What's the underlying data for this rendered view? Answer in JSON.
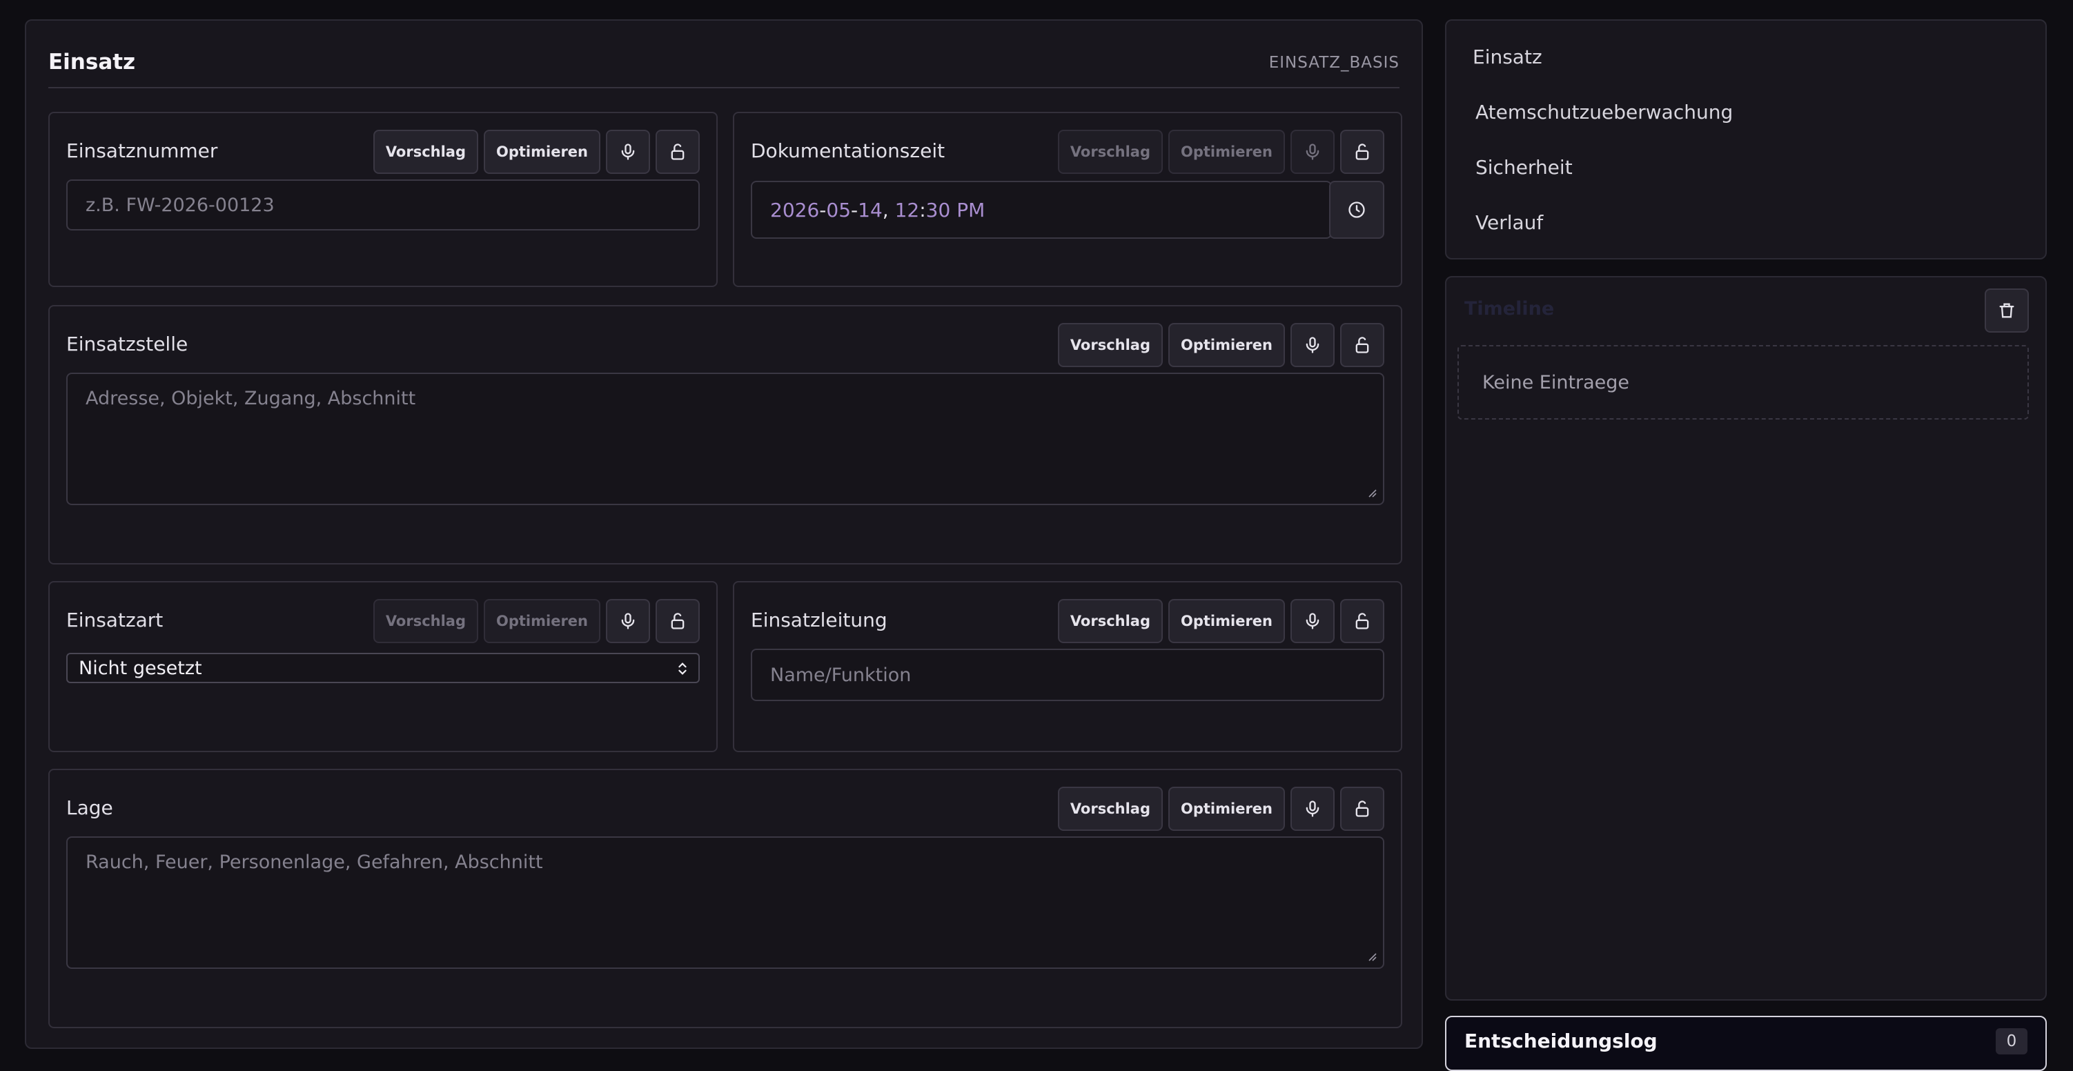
{
  "main": {
    "title": "Einsatz",
    "code": "EINSATZ_BASIS"
  },
  "buttons": {
    "suggest": "Vorschlag",
    "optimize": "Optimieren"
  },
  "fields": {
    "einsatznummer": {
      "label": "Einsatznummer",
      "placeholder": "z.B. FW-2026-00123"
    },
    "dokumentationszeit": {
      "label": "Dokumentationszeit",
      "date_year": "2026",
      "date_month": "05",
      "date_day": "14",
      "time_hour": "12",
      "time_minute": "30",
      "time_ampm": "PM"
    },
    "einsatzstelle": {
      "label": "Einsatzstelle",
      "placeholder": "Adresse, Objekt, Zugang, Abschnitt"
    },
    "einsatzart": {
      "label": "Einsatzart",
      "selected": "Nicht gesetzt"
    },
    "einsatzleitung": {
      "label": "Einsatzleitung",
      "placeholder": "Name/Funktion"
    },
    "lage": {
      "label": "Lage",
      "placeholder": "Rauch, Feuer, Personenlage, Gefahren, Abschnitt"
    }
  },
  "sidebar": {
    "items": [
      {
        "label": "Einsatz"
      },
      {
        "label": "Atemschutzueberwachung"
      },
      {
        "label": "Sicherheit"
      },
      {
        "label": "Verlauf"
      }
    ]
  },
  "log": {
    "title": "Timeline",
    "empty_text": "Keine Eintraege"
  },
  "decision_log": {
    "title": "Entscheidungslog",
    "count": "0"
  },
  "icons": {
    "mic": "microphone-icon",
    "lock": "unlock-icon",
    "clock": "clock-icon",
    "trash": "trash-icon",
    "select": "chevron-up-down-icon"
  },
  "colors": {
    "background": "#0e0d12",
    "panel": "#18161d",
    "date_accent": "#a98ed0"
  }
}
